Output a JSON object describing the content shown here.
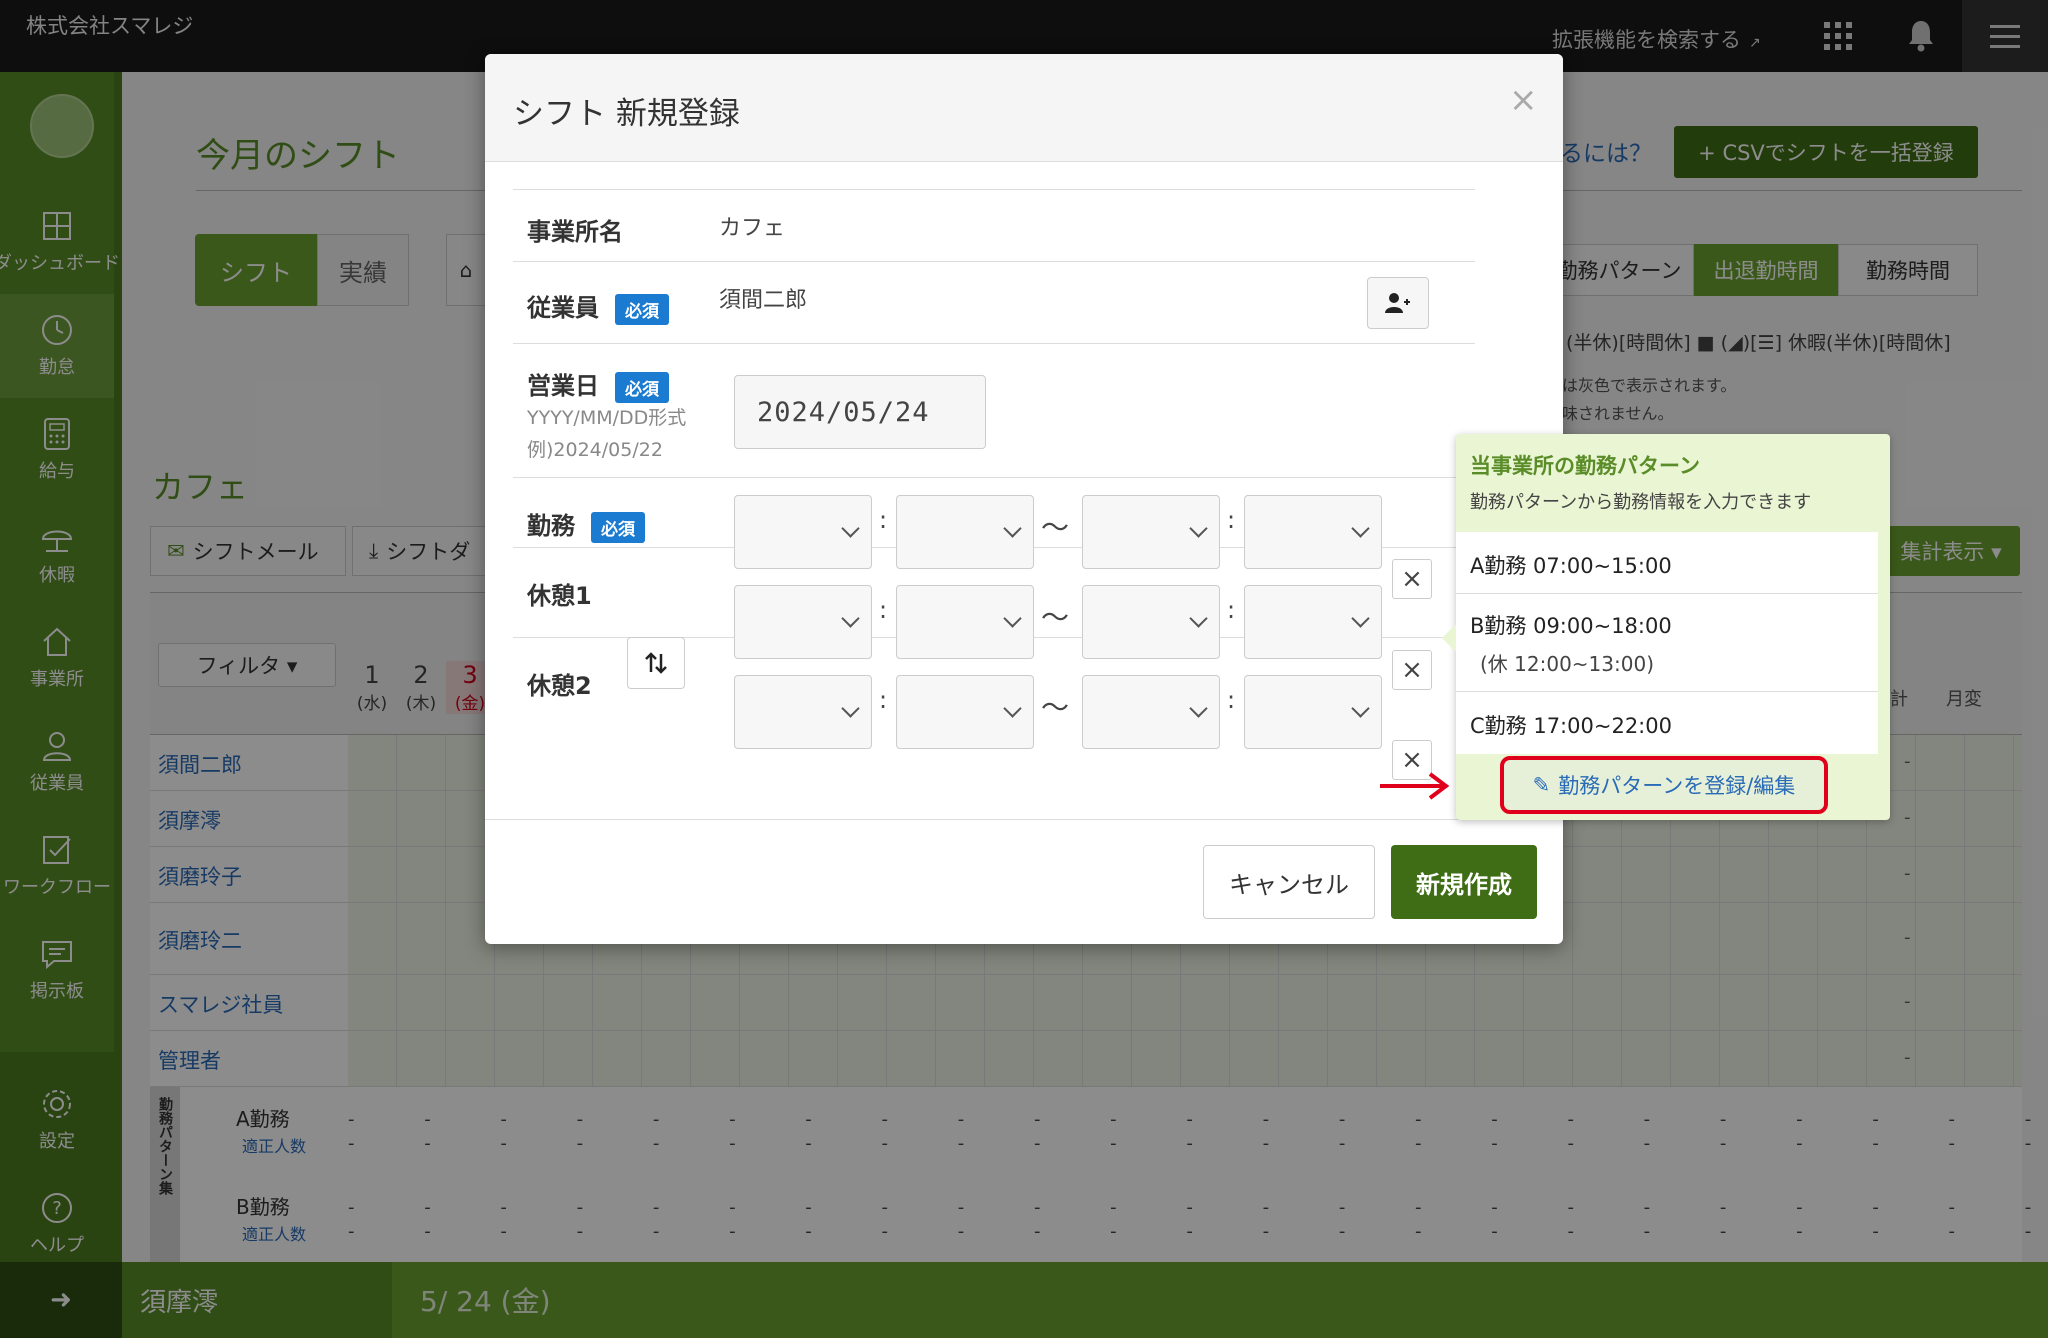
{
  "topbar": {
    "company": "株式会社スマレジ",
    "extension_search": "拡張機能を検索する",
    "icons": [
      "external-link-icon",
      "apps-grid-icon",
      "bell-icon",
      "menu-icon"
    ]
  },
  "sidebar": {
    "items": [
      {
        "label": "ダッシュボード",
        "icon": "dashboard-icon"
      },
      {
        "label": "勤怠",
        "icon": "clock-icon"
      },
      {
        "label": "給与",
        "icon": "calculator-icon"
      },
      {
        "label": "休暇",
        "icon": "umbrella-icon"
      },
      {
        "label": "事業所",
        "icon": "home-icon"
      },
      {
        "label": "従業員",
        "icon": "person-icon"
      },
      {
        "label": "ワークフロー",
        "icon": "checklist-icon"
      },
      {
        "label": "掲示板",
        "icon": "chat-icon"
      },
      {
        "label": "設定",
        "icon": "gear-icon"
      },
      {
        "label": "ヘルプ",
        "icon": "help-icon"
      }
    ],
    "collapse_glyph": "➜"
  },
  "page": {
    "title": "今月のシフト",
    "help_link": "るには？",
    "csv_button": "+ CSVでシフトを一括登録",
    "tab_shift": "シフト",
    "tab_actual": "実績",
    "view_tabs": [
      "勤務パターン",
      "出退勤時間",
      "勤務時間"
    ],
    "legend": "(半休)[時間休]  ■ (◢)[☰] 休暇(半休)[時間休]",
    "legend_note_1": "は灰色で表示されます。",
    "legend_note_2": "味されません。",
    "store": "カフェ",
    "btn_mail": "シフトメール",
    "btn_download": "シフトダ",
    "agg_button": "集計表示 ▾",
    "filter_button": "フィルタ ▾",
    "days": [
      {
        "num": "1",
        "dow": "(水)"
      },
      {
        "num": "2",
        "dow": "(木)"
      },
      {
        "num": "3",
        "dow": "(金)"
      }
    ],
    "col_total": "計",
    "col_month": "月変",
    "employees": [
      "須間二郎",
      "須摩澪",
      "須磨玲子",
      "須磨玲二",
      "スマレジ社員",
      "管理者"
    ],
    "row_dash": "-",
    "pattern_section_label": "勤務パターン集",
    "patterns": [
      {
        "name": "A勤務",
        "sub": "適正人数"
      },
      {
        "name": "B勤務",
        "sub": "適正人数"
      }
    ],
    "pattern_dashes": "- - - - - - - - - - - - - - - - - - - - - - - - - - - - - - - - - - - - - - - -"
  },
  "bottom_bar": {
    "name": "須摩澪",
    "date": "5/ 24 (金)"
  },
  "modal": {
    "title": "シフト 新規登録",
    "close": "×",
    "office_label": "事業所名",
    "office_value": "カフェ",
    "employee_label": "従業員",
    "employee_value": "須間二郎",
    "required": "必須",
    "date_label": "営業日",
    "date_hint_1": "YYYY/MM/DD形式",
    "date_hint_2": "例)2024/05/22",
    "date_value": "2024/05/24",
    "work_label": "勤務",
    "break1_label": "休憩1",
    "break2_label": "休憩2",
    "colon": ":",
    "tilde": "〜",
    "clear": "×",
    "cancel": "キャンセル",
    "create": "新規作成"
  },
  "popover": {
    "title": "当事業所の勤務パターン",
    "description": "勤務パターンから勤務情報を入力できます",
    "items": [
      {
        "label": "A勤務 07:00~15:00",
        "break": ""
      },
      {
        "label": "B勤務 09:00~18:00",
        "break": "(休 12:00~13:00)"
      },
      {
        "label": "C勤務 17:00~22:00",
        "break": ""
      }
    ],
    "edit_button": "勤務パターンを登録/編集"
  },
  "colors": {
    "brand_green": "#5a8c28",
    "dark_green": "#3f6d15",
    "link_blue": "#2a6bb8",
    "required_blue": "#1a7bd1",
    "highlight_red": "#e0001b"
  }
}
